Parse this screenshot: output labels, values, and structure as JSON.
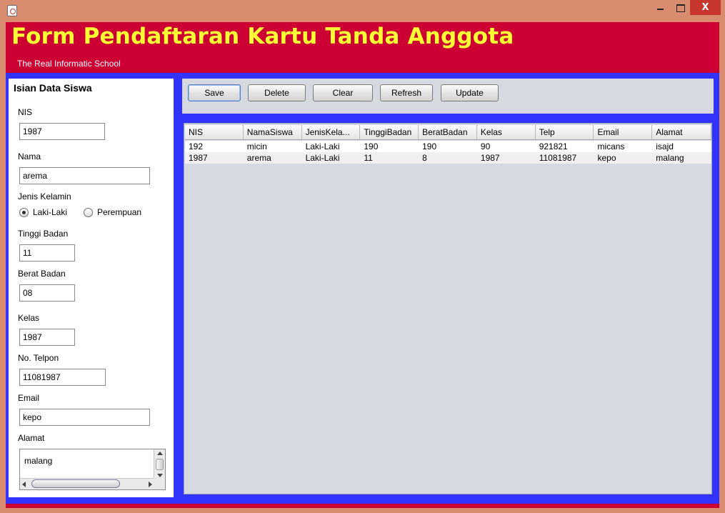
{
  "window": {
    "close_glyph": "X"
  },
  "header": {
    "title": "Form Pendaftaran Kartu Tanda Anggota",
    "subtitle": "The Real Informatic School",
    "bg_color": "#cc0033",
    "title_color": "#ffff33"
  },
  "form": {
    "title": "Isian Data Siswa",
    "nis_label": "NIS",
    "nis_value": "1987",
    "nama_label": "Nama",
    "nama_value": "arema",
    "gender_label": "Jenis Kelamin",
    "gender_options": [
      "Laki-Laki",
      "Perempuan"
    ],
    "gender_selected": "Laki-Laki",
    "tinggi_label": "Tinggi Badan",
    "tinggi_value": "11",
    "berat_label": "Berat Badan",
    "berat_value": "08",
    "kelas_label": "Kelas",
    "kelas_value": "1987",
    "telpon_label": "No. Telpon",
    "telpon_value": "11081987",
    "email_label": "Email",
    "email_value": "kepo",
    "alamat_label": "Alamat",
    "alamat_value": "malang"
  },
  "toolbar": {
    "save": "Save",
    "delete": "Delete",
    "clear": "Clear",
    "refresh": "Refresh",
    "update": "Update"
  },
  "table": {
    "columns": [
      "NIS",
      "NamaSiswa",
      "JenisKela...",
      "TinggiBadan",
      "BeratBadan",
      "Kelas",
      "Telp",
      "Email",
      "Alamat"
    ],
    "rows": [
      [
        "192",
        "micin",
        "Laki-Laki",
        "190",
        "190",
        "90",
        "921821",
        "micans",
        "isajd"
      ],
      [
        "1987",
        "arema",
        "Laki-Laki",
        "11",
        "8",
        "1987",
        "11081987",
        "kepo",
        "malang"
      ]
    ]
  },
  "colors": {
    "main_bg": "#3333ff",
    "panel_bg": "#d6d9df",
    "window_frame": "#d98b70"
  }
}
